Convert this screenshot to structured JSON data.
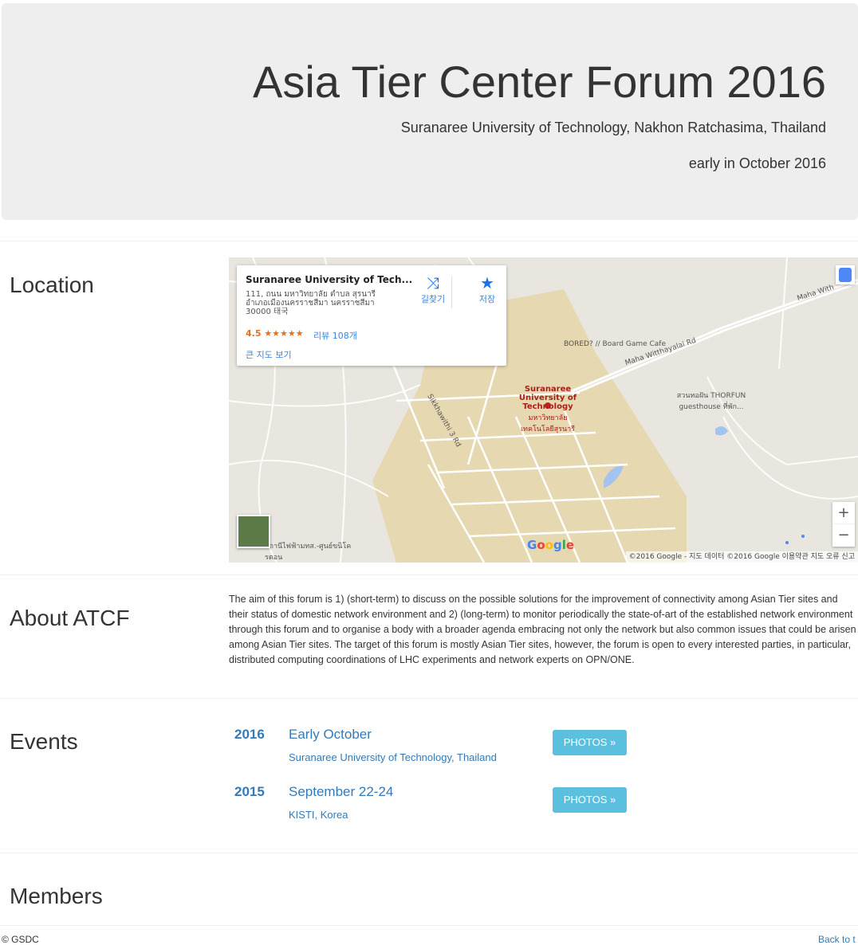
{
  "header": {
    "title": "Asia Tier Center Forum 2016",
    "subtitle": "Suranaree University of Technology, Nakhon Ratchasima, Thailand",
    "date": "early in October 2016"
  },
  "location": {
    "heading": "Location",
    "map": {
      "card_name": "Suranaree University of Tech...",
      "card_address": "111, ถนน มหาวิทยาลัย ตำบล สุรนารี อำเภอเมืองนครราชสีมา นครราชสีมา 30000 태국",
      "rating": "4.5 ★★★★★",
      "reviews": "리뷰 108개",
      "larger_map": "큰 지도 보기",
      "directions_label": "길찾기",
      "save_label": "저장",
      "poi_board_game": "BORED? // Board Game Cafe",
      "poi_university": "Suranaree University of Technology",
      "poi_university_thai": "มหาวิทยาลัยเทคโนโลยีสุรนารี",
      "poi_guesthouse": "สวนทอฝัน THORFUN guesthouse ที่พัก...",
      "poi_station": "สถานีไฟฟ้ามทส.-ศูนย์ขนิโครตอน",
      "road_maha": "Maha Witthayalai Rd",
      "road_maha_short": "Maha With",
      "road_sikkha": "Sikkhawithi 3 Rd",
      "zoom_in": "+",
      "zoom_out": "−",
      "google": "Google",
      "footer": "©2016 Google - 지도 데이터 ©2016 Google   이용약관   지도 오류 신고"
    }
  },
  "about": {
    "heading": "About ATCF",
    "text": " The aim of this forum is 1) (short-term) to discuss on the possible solutions for the improvement of connectivity among Asian Tier sites and their status of domestic network environment and 2) (long-term) to monitor periodically the state-of-art of the established network environment through this forum and to organise a body with a broader agenda embracing not only the network but also common issues that could be arisen among Asian Tier sites. The target of this forum is mostly Asian Tier sites, however, the forum is open to every interested parties, in particular, distributed computing coordinations of LHC experiments and network experts on OPN/ONE."
  },
  "events": {
    "heading": "Events",
    "items": [
      {
        "year": "2016",
        "title": "Early October",
        "location": "Suranaree University of Technology, Thailand",
        "button": "PHOTOS »"
      },
      {
        "year": "2015",
        "title": "September 22-24",
        "location": "KISTI, Korea",
        "button": "PHOTOS »"
      }
    ]
  },
  "members": {
    "heading": "Members"
  },
  "footer": {
    "copyright": "© GSDC",
    "back_to_top": "Back to t"
  },
  "colors": {
    "link": "#337ab7",
    "button": "#5bc0de",
    "jumbotron": "#eeeeee"
  }
}
